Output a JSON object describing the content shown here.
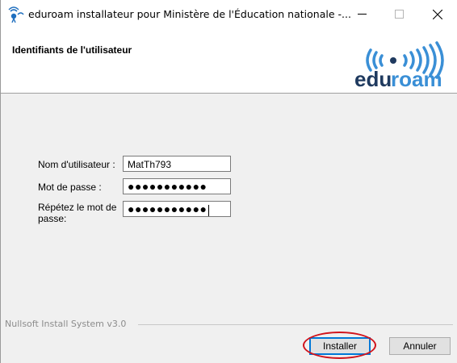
{
  "window": {
    "title": "eduroam installateur pour Ministère de l'Éducation nationale -...",
    "icon": "eduroam-app-icon",
    "controls": {
      "minimize": "minimize-icon",
      "maximize": "maximize-icon",
      "close": "close-icon"
    }
  },
  "header": {
    "title": "Identifiants de l'utilisateur",
    "logo_text": "eduroam",
    "logo_text_edu": "edu",
    "logo_text_roam": "roam",
    "colors": {
      "edu": "#1f3a5f",
      "roam": "#3a8fd6",
      "waves": "#3a8fd6"
    }
  },
  "form": {
    "username": {
      "label": "Nom d'utilisateur :",
      "value": "MatTh793"
    },
    "password": {
      "label": "Mot de passe :",
      "value": "●●●●●●●●●●●"
    },
    "confirm": {
      "label_line1": "Répétez le mot de",
      "label_line2": "passe:",
      "value": "●●●●●●●●●●●"
    }
  },
  "footer": {
    "system_text": "Nullsoft Install System v3.0",
    "install_button": "Installer",
    "cancel_button": "Annuler",
    "highlight_color": "#d0141c",
    "focus_color": "#0078d7"
  }
}
